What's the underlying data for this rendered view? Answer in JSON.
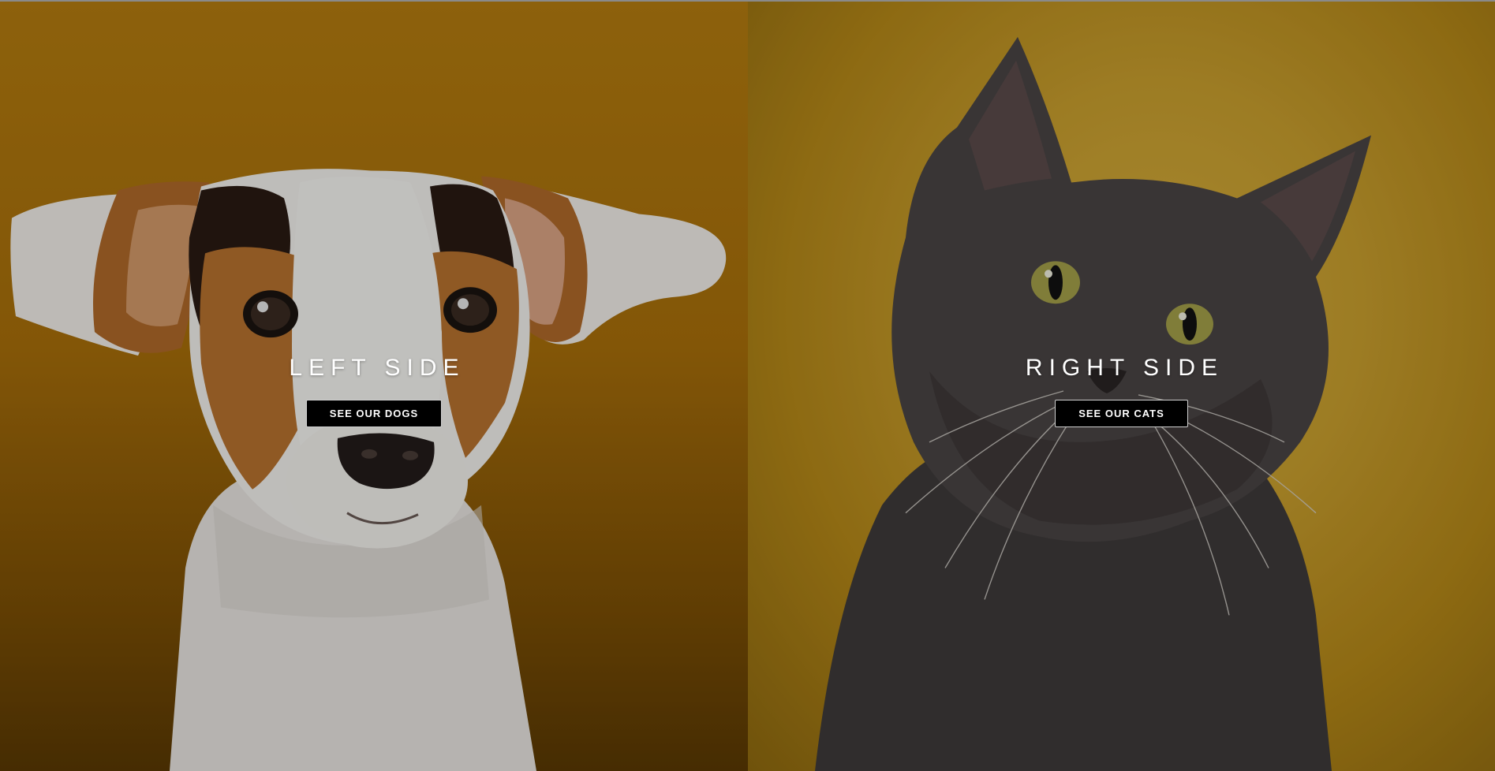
{
  "left": {
    "title": "LEFT SIDE",
    "button_label": "SEE OUR DOGS",
    "image_subject": "dog-photo",
    "background_color": "#b57d10"
  },
  "right": {
    "title": "RIGHT SIDE",
    "button_label": "SEE OUR CATS",
    "image_subject": "cat-photo",
    "background_color": "#c99f2e"
  },
  "colors": {
    "button_bg": "#000000",
    "button_text": "#ffffff",
    "title_text": "#ffffff"
  }
}
